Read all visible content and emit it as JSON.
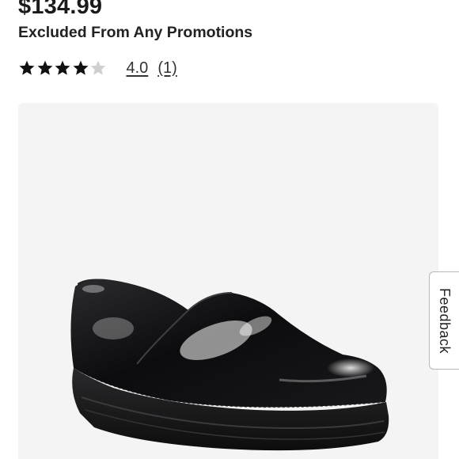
{
  "product": {
    "price": "$134.99",
    "promo_note": "Excluded From Any Promotions",
    "rating": {
      "value_label": "4.0",
      "review_count_label": "(1)",
      "stars_filled": 4,
      "stars_total": 5
    },
    "image": {
      "subject": "black patent leather clog"
    }
  },
  "feedback_tab": {
    "label": "Feedback"
  },
  "colors": {
    "star_filled": "#111111",
    "star_empty": "#cfcfcf",
    "image_panel_bg": "#f4f4f4",
    "text": "#1a1a1a"
  },
  "icons": {
    "star": "star-icon"
  }
}
